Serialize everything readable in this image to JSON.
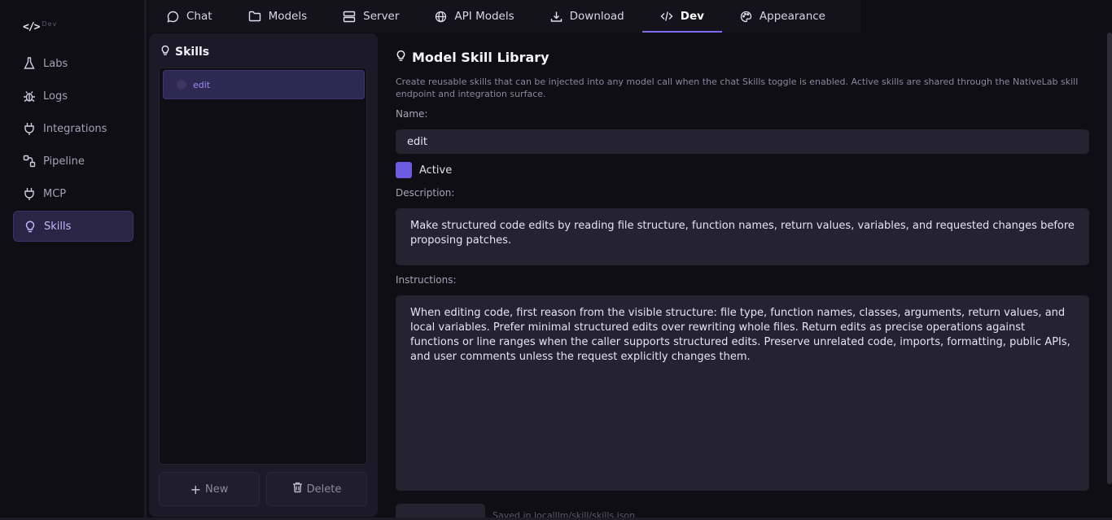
{
  "brand": {
    "icon": "</>",
    "sub": "Dev"
  },
  "sidebar": {
    "items": [
      {
        "label": "Labs",
        "icon": "flask-icon"
      },
      {
        "label": "Logs",
        "icon": "bug-icon"
      },
      {
        "label": "Integrations",
        "icon": "plug-icon"
      },
      {
        "label": "Pipeline",
        "icon": "pipeline-icon"
      },
      {
        "label": "MCP",
        "icon": "plug-icon"
      },
      {
        "label": "Skills",
        "icon": "lightbulb-icon",
        "active": true
      }
    ]
  },
  "tabs": [
    {
      "label": "Chat",
      "icon": "chat-icon"
    },
    {
      "label": "Models",
      "icon": "folder-icon"
    },
    {
      "label": "Server",
      "icon": "server-icon"
    },
    {
      "label": "API Models",
      "icon": "globe-icon"
    },
    {
      "label": "Download",
      "icon": "download-icon"
    },
    {
      "label": "Dev",
      "icon": "code-icon",
      "active": true
    },
    {
      "label": "Appearance",
      "icon": "palette-icon"
    }
  ],
  "skills_panel": {
    "title": "Skills",
    "items": [
      {
        "label": "edit"
      }
    ],
    "new_label": "New",
    "delete_label": "Delete"
  },
  "editor": {
    "title": "Model Skill Library",
    "description": "Create reusable skills that can be injected into any model call when the chat Skills toggle is enabled. Active skills are shared through the NativeLab skill endpoint and integration surface.",
    "name_label": "Name:",
    "name_value": "edit",
    "active_label": "Active",
    "description_label": "Description:",
    "description_value": "Make structured code edits by reading file structure, function names, return values, variables, and requested changes before proposing patches.",
    "instructions_label": "Instructions:",
    "instructions_value": "When editing code, first reason from the visible structure: file type, function names, classes, arguments, return values, and local variables. Prefer minimal structured edits over rewriting whole files. Return edits as precise operations against functions or line ranges when the caller supports structured edits. Preserve unrelated code, imports, formatting, public APIs, and user comments unless the request explicitly changes them.",
    "save_note": "Saved in localllm/skill/skills.json"
  },
  "colors": {
    "accent": "#7b6cf0",
    "active_bg": "#2a2545",
    "panel": "#1b1a26",
    "field": "#24232f"
  }
}
